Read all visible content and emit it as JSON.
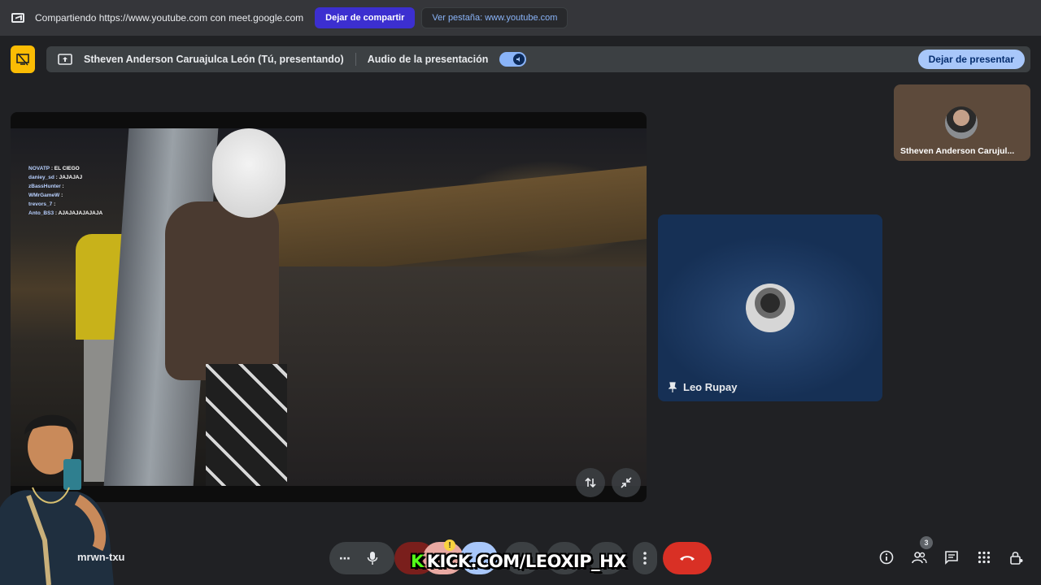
{
  "share_bar": {
    "status_text": "Compartiendo https://www.youtube.com con meet.google.com",
    "stop_share_label": "Dejar de compartir",
    "view_tab_label": "Ver pestaña: www.youtube.com"
  },
  "presentation": {
    "presenter_label": "Stheven Anderson Caruajulca León (Tú, presentando)",
    "audio_label": "Audio de la presentación",
    "stop_present_label": "Dejar de presentar"
  },
  "chat_overlay": [
    {
      "user": "NOVATP",
      "msg": "EL CIEGO"
    },
    {
      "user": "daniey_sd",
      "msg": "JAJAJAJ"
    },
    {
      "user": "zBassHunter",
      "msg": ""
    },
    {
      "user": "WMrGameW",
      "msg": ""
    },
    {
      "user": "trevors_7",
      "msg": ""
    },
    {
      "user": "Anto_BS3",
      "msg": "AJAJAJAJAJAJA"
    }
  ],
  "participants": {
    "self_name": "Stheven Anderson Carujul...",
    "pinned_name": "Leo Rupay"
  },
  "meeting": {
    "name": "mrwn-txu",
    "people_count": "3"
  },
  "overlay": {
    "kick_text": "KICK.COM/LEOXIP_HX",
    "kick_letter": "K"
  },
  "colors": {
    "accent_purple": "#3c2fd0",
    "present_yellow": "#fbbc04",
    "end_call_red": "#d93025",
    "kick_green": "#53fc18"
  }
}
